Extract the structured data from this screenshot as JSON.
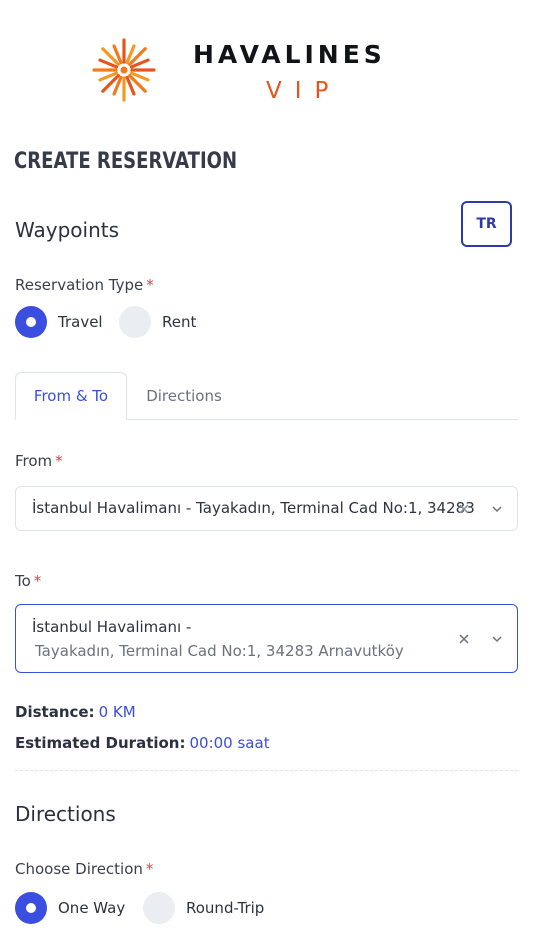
{
  "brand": {
    "name": "HAVALINES",
    "sub": "VIP",
    "accent": "#e8541e",
    "logo_icon": "sunburst-icon"
  },
  "page": {
    "title": "CREATE RESERVATION",
    "language_button": "TR"
  },
  "waypoints": {
    "section_title": "Waypoints",
    "reservation_type": {
      "label": "Reservation Type",
      "required_mark": "*",
      "options": [
        {
          "label": "Travel",
          "selected": true
        },
        {
          "label": "Rent",
          "selected": false
        }
      ]
    },
    "tabs": [
      {
        "label": "From & To",
        "active": true
      },
      {
        "label": "Directions",
        "active": false
      }
    ],
    "from": {
      "label": "From",
      "required_mark": "*",
      "value": "İstanbul Havalimanı - Tayakadın, Terminal Cad No:1, 34283"
    },
    "to": {
      "label": "To",
      "required_mark": "*",
      "value_line1": "İstanbul Havalimanı -",
      "value_line2": "Tayakadın, Terminal Cad No:1, 34283 Arnavutköy"
    },
    "distance": {
      "label": "Distance:",
      "value": "0 KM"
    },
    "duration": {
      "label": "Estimated Duration:",
      "value": "00:00 saat"
    }
  },
  "directions": {
    "section_title": "Directions",
    "choose": {
      "label": "Choose Direction",
      "required_mark": "*",
      "options": [
        {
          "label": "One Way",
          "selected": true
        },
        {
          "label": "Round-Trip",
          "selected": false
        }
      ]
    }
  },
  "colors": {
    "primary": "#3a4ee0",
    "required": "#e0414a",
    "border": "#dfe3ea"
  }
}
